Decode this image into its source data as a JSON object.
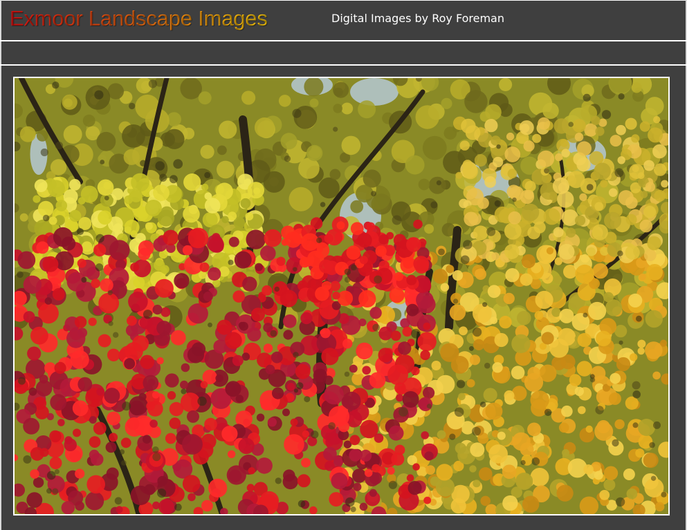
{
  "header": {
    "site_title": "Exmoor Landscape Images",
    "subtitle": "Digital Images by Roy Foreman"
  },
  "photo": {
    "subject": "autumn-maple-trees",
    "colors": {
      "red_maple": "#d4141e",
      "crimson": "#9e1730",
      "gold": "#e8b020",
      "yellow_green": "#b8b423",
      "olive": "#6f6a1c",
      "sky": "#b9d0ec",
      "branch": "#2b2416"
    }
  },
  "theme": {
    "background": "#3f3f3f",
    "rule_color": "#ffffff"
  }
}
